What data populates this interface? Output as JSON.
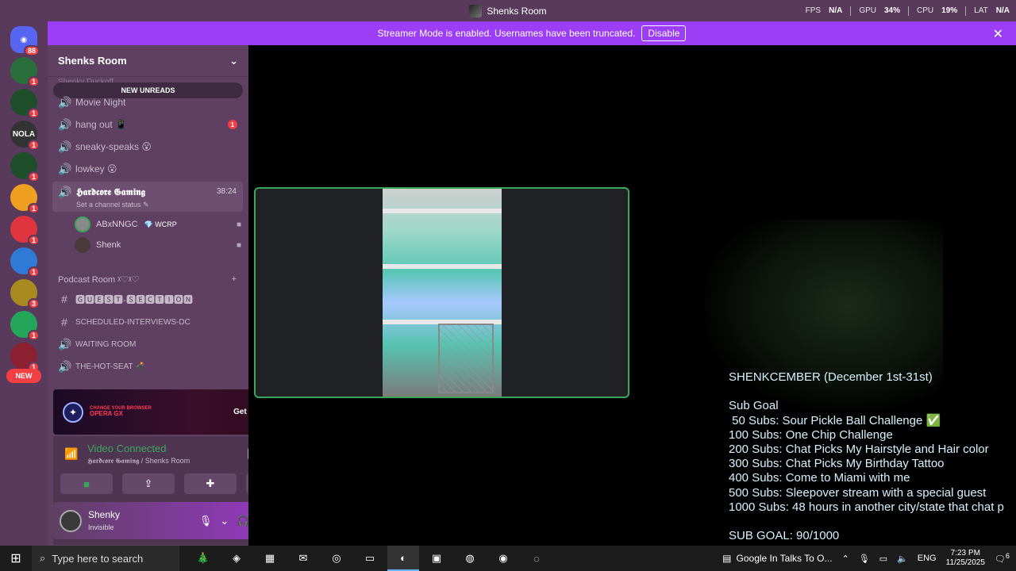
{
  "title_bar": {
    "title": "Shenks Room",
    "fps_label": "FPS",
    "fps_value": "N/A",
    "gpu_label": "GPU",
    "gpu_value": "34%",
    "cpu_label": "CPU",
    "cpu_value": "19%",
    "lat_label": "LAT",
    "lat_value": "N/A"
  },
  "server_rail": {
    "home_badge": "88",
    "servers": [
      {
        "badge": "1",
        "color": "#2a6e3b",
        "label": ""
      },
      {
        "badge": "1",
        "color": "#1f4f2a",
        "label": ""
      },
      {
        "badge": "1",
        "color": "#333333",
        "label": "NOLA"
      },
      {
        "badge": "1",
        "color": "#1f4f2a",
        "label": ""
      },
      {
        "badge": "1",
        "color": "#f0a020",
        "label": ""
      },
      {
        "badge": "1",
        "color": "#e0353f",
        "label": ""
      },
      {
        "badge": "1",
        "color": "#2f7ad6",
        "label": ""
      },
      {
        "badge": "3",
        "color": "#a88a20",
        "label": ""
      },
      {
        "badge": "1",
        "color": "#23a55a",
        "label": ""
      },
      {
        "badge": "1",
        "color": "#8b2030",
        "label": ""
      }
    ],
    "new_label": "NEW"
  },
  "banner": {
    "message": "Streamer Mode is enabled. Usernames have been truncated.",
    "button": "Disable"
  },
  "sidebar": {
    "guild_name": "Shenks Room",
    "ghost_category": "Shenky Duckoff",
    "new_unreads": "NEW UNREADS",
    "channels": [
      {
        "name": "Movie Night",
        "icon": "speaker-icon",
        "badge": ""
      },
      {
        "name": "hang out 📱",
        "icon": "speaker-icon",
        "badge": "1"
      },
      {
        "name": "sneaky-speaks 😮",
        "icon": "speaker-icon",
        "badge": ""
      },
      {
        "name": "lowkey 😮",
        "icon": "speaker-icon",
        "badge": ""
      }
    ],
    "active_channel": {
      "name": "𝕳𝖆𝖗𝖉𝖈𝖔𝖗𝖊 𝕲𝖆𝖒𝖎𝖓𝖌",
      "timer": "38:24",
      "status": "Set a channel status"
    },
    "voice_users": [
      {
        "name": "ABxNNGC",
        "tag": "💎 WCRP"
      },
      {
        "name": "Shenk",
        "tag": ""
      }
    ],
    "category": "Podcast Room ᵡ♡ᵡ♡",
    "podcast_channels": [
      {
        "name": "🅶🆄🅴🆂🆃-🆂🅴🅲🆃🅸🅾🅽",
        "icon": "hash-icon"
      },
      {
        "name": "SCHEDULED-INTERVIEWS-DC",
        "icon": "hash-icon"
      },
      {
        "name": "WAITING ROOM",
        "icon": "speaker-icon"
      },
      {
        "name": "THE-HOT-SEAT 💣",
        "icon": "speaker-icon"
      }
    ]
  },
  "ad": {
    "brand_line1": "CHANGE YOUR BROWSER",
    "brand_line2": "OPERA GX",
    "cta": "Get Reward!"
  },
  "voice_panel": {
    "status": "Video Connected",
    "location": "𝕳𝖆𝖗𝖉𝖈𝖔𝖗𝖊 𝕲𝖆𝖒𝖎𝖓𝖌 / Shenks Room"
  },
  "user_panel": {
    "username": "Shenky",
    "status": "Invisible"
  },
  "stream_overlay": {
    "text": "SHENKCEMBER (December 1st-31st)\n\nSub Goal\n 50 Subs: Sour Pickle Ball Challenge ✅\n100 Subs: One Chip Challenge\n200 Subs: Chat Picks My Hairstyle and Hair color\n300 Subs: Chat Picks My Birthday Tattoo\n400 Subs: Come to Miami with me\n500 Subs: Sleepover stream with a special guest\n1000 Subs: 48 hours in another city/state that chat p\n\nSUB GOAL: 90/1000"
  },
  "taskbar": {
    "search_placeholder": "Type here to search",
    "news": "Google In Talks To O...",
    "language": "ENG",
    "time": "7:23 PM",
    "date": "11/25/2025",
    "notifications": "6"
  }
}
